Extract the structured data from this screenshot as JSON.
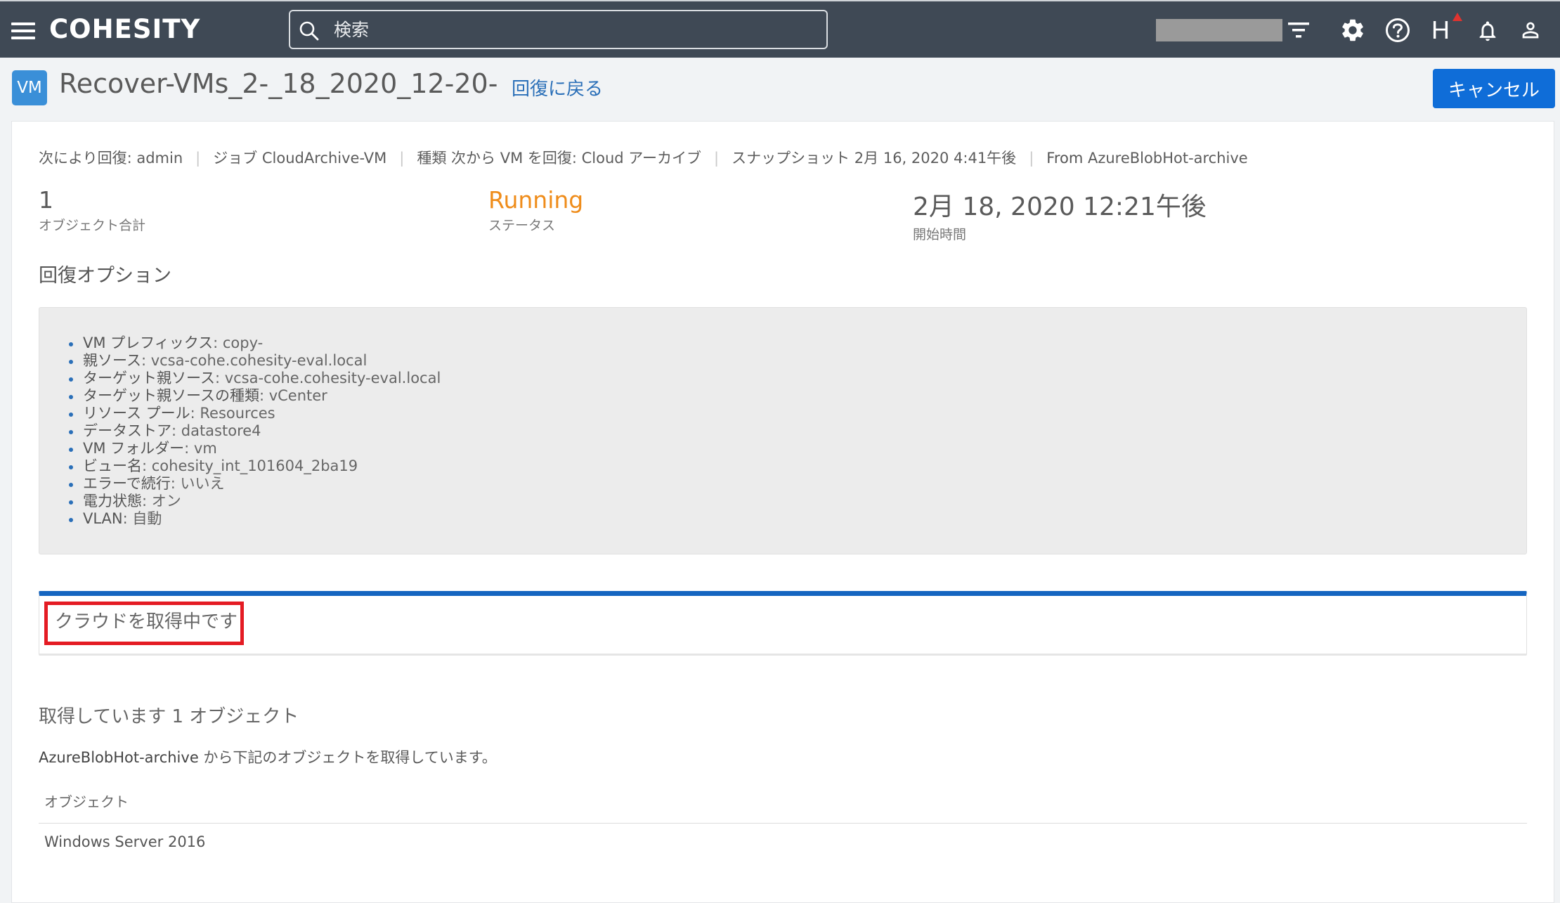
{
  "header": {
    "logo": "COHESITY",
    "search_placeholder": "検索",
    "profile_initial": "H"
  },
  "icons": [
    "menu-icon",
    "search-icon",
    "filter-icon",
    "gear-icon",
    "help-icon",
    "alert-icon",
    "bell-icon",
    "user-icon"
  ],
  "page": {
    "badge": "VM",
    "title": "Recover-VMs_2-_18_2020_12-20-",
    "back_link": "回復に戻る",
    "cancel_label": "キャンセル"
  },
  "meta": {
    "recovered_by": "次により回復: admin",
    "job": "ジョブ CloudArchive-VM",
    "type": "種類 次から VM を回復: Cloud アーカイブ",
    "snapshot": "スナップショット 2月 16, 2020 4:41午後",
    "from_label": "From",
    "from_value": "AzureBlobHot-archive"
  },
  "stats": {
    "objects_value": "1",
    "objects_label": "オブジェクト合計",
    "status_value": "Running",
    "status_label": "ステータス",
    "start_value": "2月 18, 2020 12:21午後",
    "start_label": "開始時間"
  },
  "options_title": "回復オプション",
  "options": [
    {
      "key": "VM プレフィックス",
      "value": ": copy-"
    },
    {
      "key": "親ソース",
      "value": ": vcsa-cohe.cohesity-eval.local"
    },
    {
      "key": "ターゲット親ソース",
      "value": ": vcsa-cohe.cohesity-eval.local"
    },
    {
      "key": "ターゲット親ソースの種類",
      "value": ": vCenter"
    },
    {
      "key": "リソース プール",
      "value": ": Resources"
    },
    {
      "key": "データストア",
      "value": ": datastore4"
    },
    {
      "key": "VM フォルダー",
      "value": ": vm"
    },
    {
      "key": "ビュー名",
      "value": ": cohesity_int_101604_2ba19"
    },
    {
      "key": "エラーで続行",
      "value": ": いいえ"
    },
    {
      "key": "電力状態",
      "value": ": オン"
    },
    {
      "key": "VLAN",
      "value": ": 自動"
    }
  ],
  "progress_text": "クラウドを取得中です",
  "retrieve": {
    "title": "取得しています 1 オブジェクト",
    "desc_source": "AzureBlobHot-archive",
    "desc_rest": " から下記のオブジェクトを取得しています。",
    "column_header": "オブジェクト",
    "rows": [
      "Windows Server 2016"
    ]
  },
  "colors": {
    "topbar": "#3f4955",
    "accent": "#0f6dd8",
    "running": "#ef8c1a",
    "highlight": "#e41b23"
  }
}
